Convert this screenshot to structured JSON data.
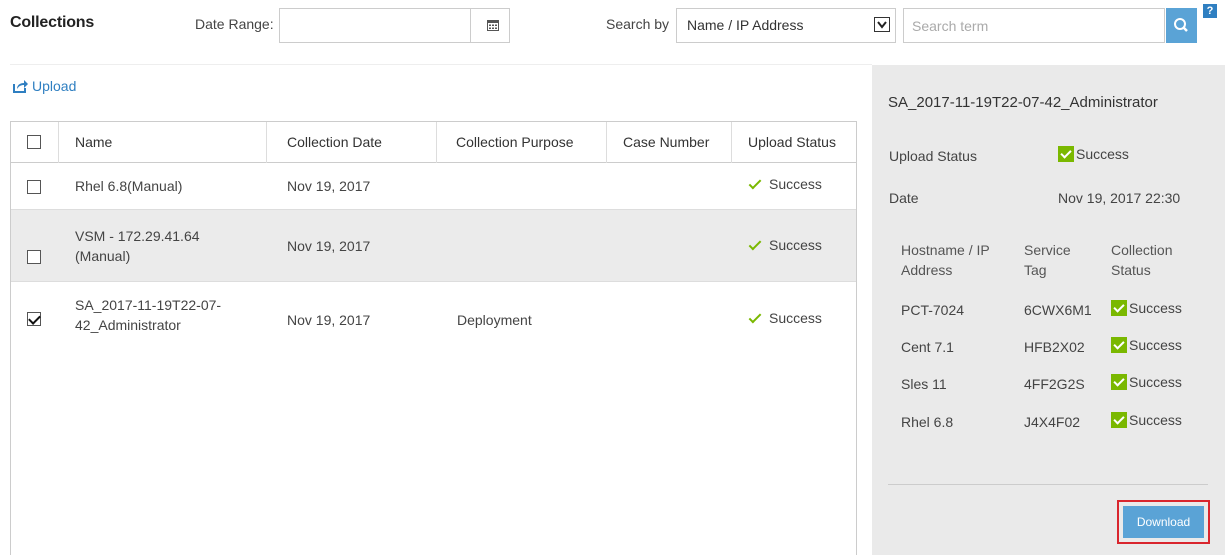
{
  "header": {
    "title": "Collections",
    "date_range_label": "Date Range:",
    "date_range_value": "",
    "search_by_label": "Search by",
    "search_by_selected": "Name / IP Address",
    "search_placeholder": "Search term",
    "help_label": "?"
  },
  "upload_label": "Upload",
  "table": {
    "columns": [
      "Name",
      "Collection Date",
      "Collection Purpose",
      "Case Number",
      "Upload Status"
    ],
    "rows": [
      {
        "name": "Rhel 6.8(Manual)",
        "date": "Nov 19, 2017",
        "purpose": "",
        "case": "",
        "status": "Success",
        "checked": false
      },
      {
        "name_line1": "VSM - 172.29.41.64",
        "name_line2": "(Manual)",
        "date": "Nov 19, 2017",
        "purpose": "",
        "case": "",
        "status": "Success",
        "checked": false
      },
      {
        "name_line1": "SA_2017-11-19T22-07-",
        "name_line2": "42_Administrator",
        "date": "Nov 19, 2017",
        "purpose": "Deployment",
        "case": "",
        "status": "Success",
        "checked": true
      }
    ]
  },
  "detail": {
    "title": "SA_2017-11-19T22-07-42_Administrator",
    "upload_status_label": "Upload Status",
    "upload_status_value": "Success",
    "date_label": "Date",
    "date_value": "Nov 19, 2017 22:30",
    "sub_columns": {
      "host_line1": "Hostname / IP",
      "host_line2": "Address",
      "tag_line1": "Service",
      "tag_line2": "Tag",
      "status_line1": "Collection",
      "status_line2": "Status"
    },
    "devices": [
      {
        "host": "PCT-7024",
        "tag": "6CWX6M1",
        "status": "Success"
      },
      {
        "host": "Cent 7.1",
        "tag": "HFB2X02",
        "status": "Success"
      },
      {
        "host": "Sles 11",
        "tag": "4FF2G2S",
        "status": "Success"
      },
      {
        "host": "Rhel 6.8",
        "tag": "J4X4F02",
        "status": "Success"
      }
    ],
    "download_label": "Download"
  },
  "colors": {
    "accent": "#2f7fc1",
    "button": "#5aa3d6",
    "success": "#7ab800",
    "highlight": "#d9262e"
  }
}
